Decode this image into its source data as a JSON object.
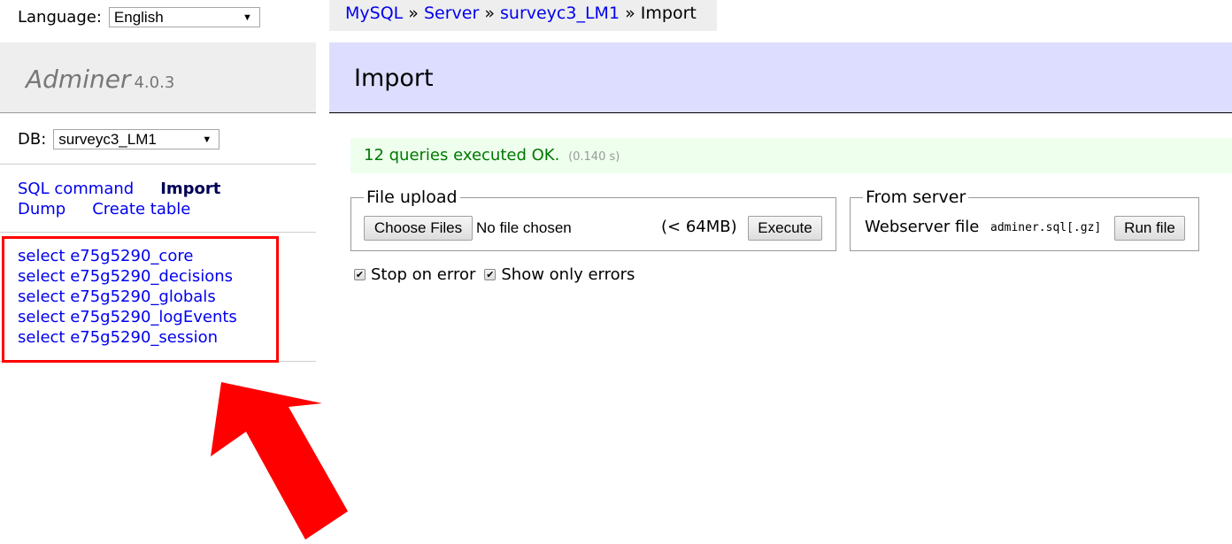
{
  "menu": {
    "language_label": "Language:",
    "language_value": "English",
    "brand_name": "Adminer",
    "brand_version": "4.0.3",
    "db_label": "DB:",
    "db_value": "surveyc3_LM1",
    "links": {
      "sql_command": "SQL command",
      "import": "Import",
      "dump": "Dump",
      "create_table": "Create table"
    },
    "tables": [
      "select e75g5290_core",
      "select e75g5290_decisions",
      "select e75g5290_globals",
      "select e75g5290_logEvents",
      "select e75g5290_session"
    ]
  },
  "breadcrumb": {
    "items": [
      "MySQL",
      "Server",
      "surveyc3_LM1"
    ],
    "separator": "»",
    "current": "Import"
  },
  "page": {
    "title": "Import",
    "message": "12 queries executed OK.",
    "message_time": "(0.140 s)"
  },
  "upload": {
    "legend": "File upload",
    "choose_files": "Choose Files",
    "no_file": "No file chosen",
    "limit": "(< 64MB)",
    "execute": "Execute"
  },
  "server": {
    "legend": "From server",
    "label": "Webserver file",
    "filename": "adminer.sql[.gz]",
    "run_file": "Run file"
  },
  "options": {
    "stop_on_error": "Stop on error",
    "show_only_errors": "Show only errors",
    "check_mark": "✔"
  },
  "annotation": {
    "highlight_color": "#ff0000"
  }
}
